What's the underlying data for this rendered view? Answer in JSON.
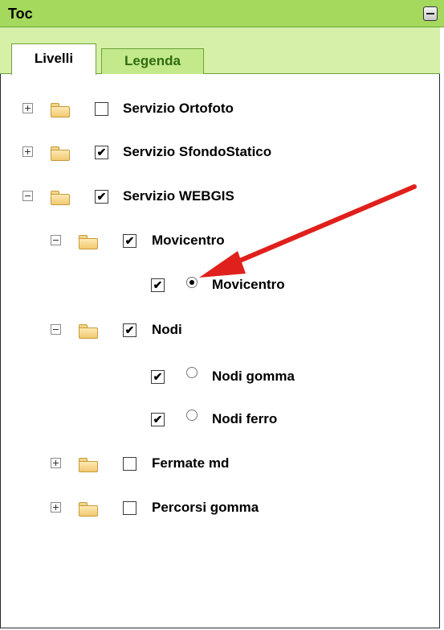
{
  "panel": {
    "title": "Toc"
  },
  "tabs": [
    {
      "label": "Livelli",
      "active": true
    },
    {
      "label": "Legenda",
      "active": false
    }
  ],
  "tree": [
    {
      "id": "ortofoto",
      "label": "Servizio Ortofoto",
      "expander": "plus",
      "checked": false
    },
    {
      "id": "sfondo",
      "label": "Servizio SfondoStatico",
      "expander": "plus",
      "checked": true
    },
    {
      "id": "webgis",
      "label": "Servizio WEBGIS",
      "expander": "minus",
      "checked": true
    },
    {
      "id": "movicentro-group",
      "label": "Movicentro",
      "expander": "minus",
      "checked": true
    },
    {
      "id": "movicentro-layer",
      "label": "Movicentro",
      "checked": true,
      "radio_selected": true
    },
    {
      "id": "nodi-group",
      "label": "Nodi",
      "expander": "minus",
      "checked": true
    },
    {
      "id": "nodi-gomma",
      "label": "Nodi gomma",
      "checked": true,
      "radio_selected": false
    },
    {
      "id": "nodi-ferro",
      "label": "Nodi ferro",
      "checked": true,
      "radio_selected": false
    },
    {
      "id": "fermate",
      "label": "Fermate md",
      "expander": "plus",
      "checked": false
    },
    {
      "id": "percorsi",
      "label": "Percorsi gomma",
      "expander": "plus",
      "checked": false
    }
  ],
  "colors": {
    "header_green": "#a4d95e",
    "tab_strip": "#d6f0a8",
    "arrow_red": "#e0201c"
  }
}
